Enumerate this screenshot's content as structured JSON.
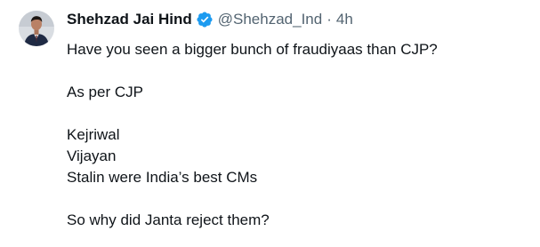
{
  "author": {
    "display_name": "Shehzad Jai Hind",
    "handle": "@Shehzad_Ind",
    "separator": "·",
    "time": "4h",
    "verified_icon": "verified-badge-icon",
    "verified_color": "#1d9bf0"
  },
  "tweet": {
    "lines": [
      "Have you seen a bigger bunch of fraudiyaas than CJP?",
      "As per CJP",
      "Kejriwal",
      "Vijayan",
      "Stalin were India’s best CMs",
      "So why did Janta reject them?"
    ]
  }
}
